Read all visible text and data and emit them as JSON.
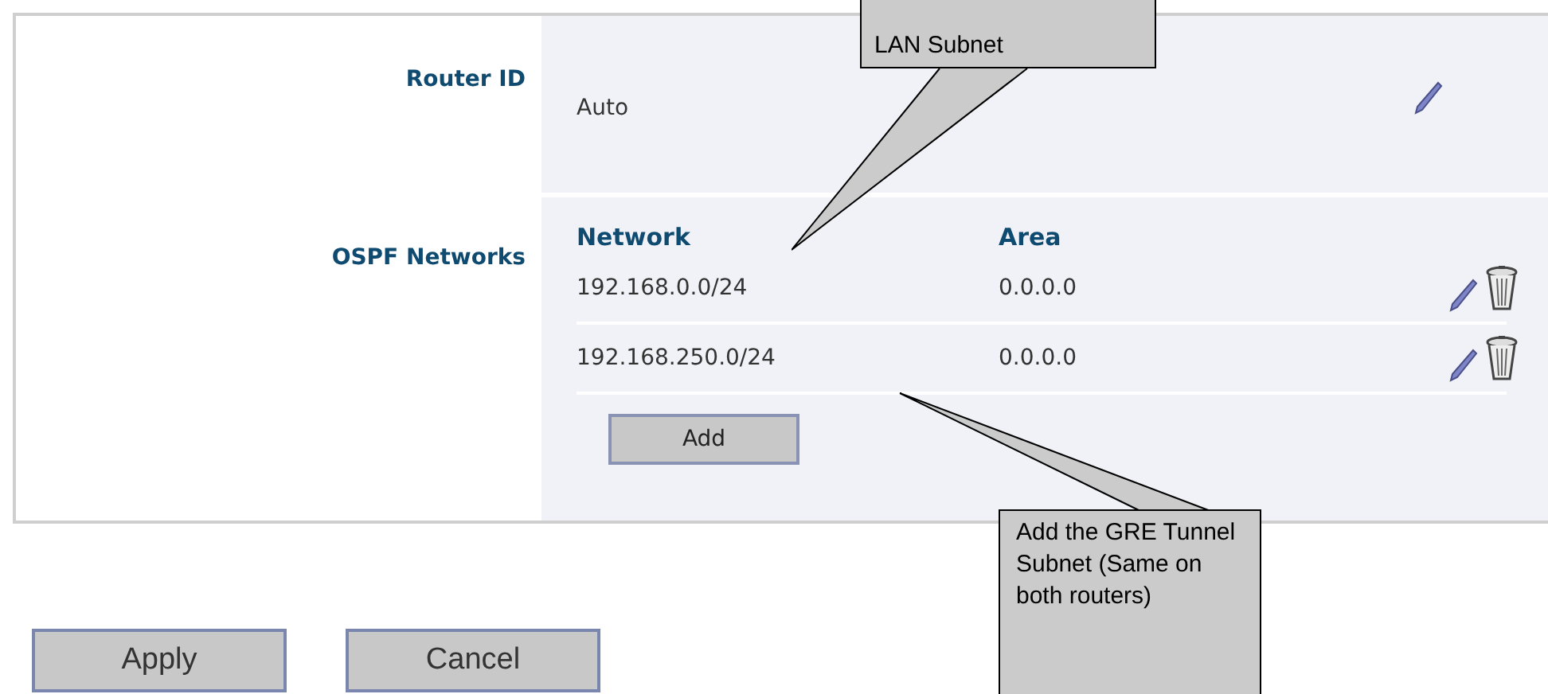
{
  "router_id": {
    "label": "Router ID",
    "value": "Auto"
  },
  "ospf_networks": {
    "label": "OSPF Networks",
    "columns": [
      "Network",
      "Area"
    ],
    "rows": [
      {
        "network": "192.168.0.0/24",
        "area": "0.0.0.0"
      },
      {
        "network": "192.168.250.0/24",
        "area": "0.0.0.0"
      }
    ],
    "add_button": "Add"
  },
  "buttons": [
    "Apply",
    "Cancel"
  ],
  "callouts": [
    {
      "text": "LAN Subnet"
    },
    {
      "text": "Add the GRE Tunnel Subnet (Same on both routers)"
    }
  ]
}
